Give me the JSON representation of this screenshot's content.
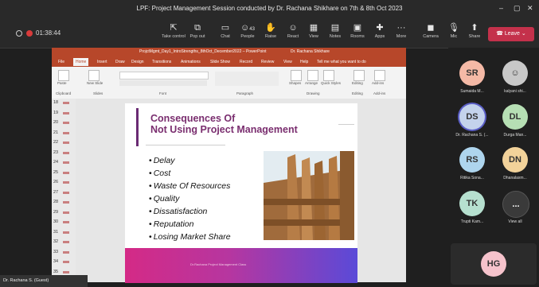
{
  "window": {
    "title": "LPF: Project Management Session conducted by Dr. Rachana Shikhare on 7th & 8th Oct 2023"
  },
  "meeting": {
    "timer": "01:38:44",
    "toolbar": [
      {
        "label": "Take control",
        "icon": "take-control-icon"
      },
      {
        "label": "Pop out",
        "icon": "pop-out-icon"
      },
      {
        "label": "Chat",
        "icon": "chat-icon"
      },
      {
        "label": "People",
        "icon": "people-icon",
        "badge": "43"
      },
      {
        "label": "Raise",
        "icon": "raise-hand-icon"
      },
      {
        "label": "React",
        "icon": "react-icon"
      },
      {
        "label": "View",
        "icon": "view-icon"
      },
      {
        "label": "Notes",
        "icon": "notes-icon"
      },
      {
        "label": "Rooms",
        "icon": "rooms-icon"
      },
      {
        "label": "Apps",
        "icon": "apps-icon"
      },
      {
        "label": "More",
        "icon": "more-icon"
      },
      {
        "label": "Camera",
        "icon": "camera-icon"
      },
      {
        "label": "Mic",
        "icon": "mic-icon"
      },
      {
        "label": "Share",
        "icon": "share-icon"
      }
    ],
    "leave_label": "Leave",
    "presenter_label": "Dr. Rachana S. (Guest)"
  },
  "powerpoint": {
    "title": "ProjctMgmt_Day1_IntroStrengths_8thOct_December2022 – PowerPoint",
    "user": "Dr. Rachana Shikhare",
    "tabs": [
      "File",
      "Home",
      "Insert",
      "Draw",
      "Design",
      "Transitions",
      "Animations",
      "Slide Show",
      "Record",
      "Review",
      "View",
      "Help",
      "Tell me what you want to do"
    ],
    "active_tab": "Home",
    "ribbon_groups": [
      "Clipboard",
      "Slides",
      "Font",
      "Paragraph",
      "Drawing",
      "Editing",
      "Add-ins"
    ],
    "ribbon_buttons": [
      "Paste",
      "New Slide",
      "Shapes",
      "Arrange",
      "Quick Styles",
      "Editing",
      "Add-ins"
    ],
    "thumb_numbers": [
      "18",
      "19",
      "20",
      "21",
      "22",
      "23",
      "24",
      "25",
      "26",
      "27",
      "28",
      "29",
      "30",
      "31",
      "32",
      "33",
      "34",
      "35"
    ]
  },
  "slide": {
    "title_line1": "Consequences Of",
    "title_line2": "Not Using Project Management",
    "bullets": [
      "Delay",
      "Cost",
      "Waste Of Resources",
      "Quality",
      "Dissatisfaction",
      "Reputation",
      "Losing Market Share"
    ],
    "footer_note": "Dr.Rachana Project Management Class"
  },
  "participants": [
    {
      "initials": "SR",
      "name": "Sumaida M...",
      "color": "#f4b9a6"
    },
    {
      "initials": "",
      "name": "kalyani shi...",
      "color": "#c8c8c8",
      "icon": "person-icon"
    },
    {
      "initials": "DS",
      "name": "Dr. Rachana S. (...",
      "color": "#c4d3ec"
    },
    {
      "initials": "DL",
      "name": "Durga Man...",
      "color": "#b6dfb4"
    },
    {
      "initials": "RS",
      "name": "Ritika Sona...",
      "color": "#aed5ee"
    },
    {
      "initials": "DN",
      "name": "Dhanalaxm...",
      "color": "#f2d29a"
    },
    {
      "initials": "TK",
      "name": "Trupti Kam...",
      "color": "#b6e0cf"
    },
    {
      "initials": "...",
      "name": "View all",
      "color": "#3a3a3a"
    },
    {
      "initials": "HG",
      "name": "",
      "color": "#f6c3cc"
    }
  ]
}
